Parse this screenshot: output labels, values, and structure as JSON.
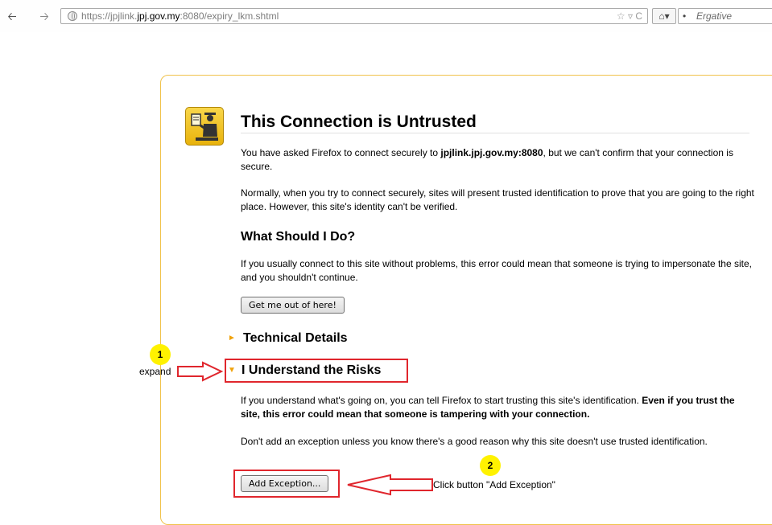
{
  "browser": {
    "url_prefix": "https://jpjlink.",
    "url_host": "jpj.gov.my",
    "url_suffix": ":8080/expiry_lkm.shtml",
    "search_placeholder": "Ergative",
    "icons": [
      "back-arrow-icon",
      "forward-arrow-icon",
      "globe-icon",
      "star-icon",
      "dropdown-icon",
      "reload-icon",
      "home-icon"
    ]
  },
  "error_page": {
    "title": "This Connection is Untrusted",
    "intro_before": "You have asked Firefox to connect securely to ",
    "intro_host": "jpjlink.jpj.gov.my:8080",
    "intro_after": ", but we can't confirm that your connection is secure.",
    "normal_text": "Normally, when you try to connect securely, sites will present trusted identification to prove that you are going to the right place. However, this site's identity can't be verified.",
    "what_heading": "What Should I Do?",
    "what_text": "If you usually connect to this site without problems, this error could mean that someone is trying to impersonate the site, and you shouldn't continue.",
    "get_out_button": "Get me out of here!",
    "technical_heading": "Technical Details",
    "risks_heading": "I Understand the Risks",
    "risks_text_before": "If you understand what's going on, you can tell Firefox to start trusting this site's identification. ",
    "risks_text_bold": "Even if you trust the site, this error could mean that someone is tampering with your connection.",
    "exception_text": "Don't add an exception unless you know there's a good reason why this site doesn't use trusted identification.",
    "add_exception_button": "Add Exception..."
  },
  "annotations": {
    "step1_number": "1",
    "step1_label": "expand",
    "step2_number": "2",
    "step2_label": "Click button \"Add Exception\"",
    "highlight_color": "#e0262d",
    "badge_color": "#fff200"
  },
  "colors": {
    "card_border": "#f0c24a",
    "expander_arrow": "#f0a20a"
  }
}
